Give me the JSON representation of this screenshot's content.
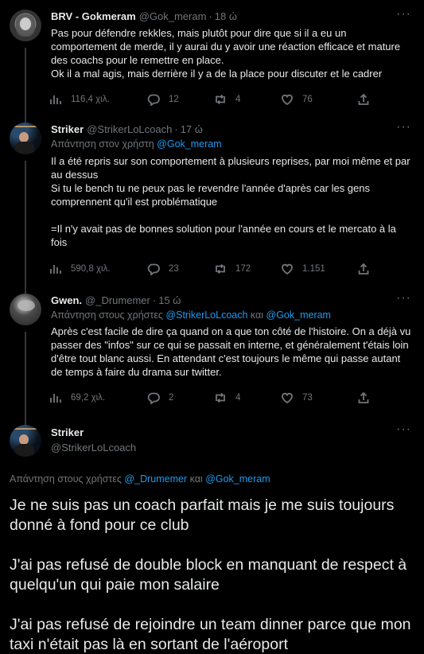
{
  "tweets": [
    {
      "name": "BRV - Gokmeram",
      "handle": "@Gok_meram",
      "time": "18 ώ",
      "text": "Pas pour défendre rekkles, mais plutôt pour dire que si il a eu un comportement de merde, il y aurai du y avoir une réaction efficace et mature des coachs pour le remettre en place.\nOk il a mal agis, mais derrière il y a de la place pour discuter et le cadrer",
      "views": "116,4 χιλ.",
      "replies": "12",
      "retweets": "4",
      "likes": "76"
    },
    {
      "name": "Striker",
      "handle": "@StrikerLoLcoach",
      "time": "17 ώ",
      "replying_prefix": "Απάντηση στον χρήστη",
      "replying_to": "@Gok_meram",
      "text": "Il a été repris sur son comportement à plusieurs reprises, par moi même et par au dessus\nSi tu le bench tu ne peux pas le revendre l'année d'après car les gens comprennent qu'il est problématique\n\n=Il n'y avait pas de bonnes solution pour l'année en cours et le mercato à la fois",
      "views": "590,8 χιλ.",
      "replies": "23",
      "retweets": "172",
      "likes": "1.151"
    },
    {
      "name": "Gwen.",
      "handle": "@_Drumemer",
      "time": "15 ώ",
      "replying_prefix": "Απάντηση στους χρήστες",
      "replying_to": "@StrikerLoLcoach",
      "replying_and": "και",
      "replying_to2": "@Gok_meram",
      "text": "Après c'est facile de dire ça quand on a que ton côté de l'histoire. On a déjà vu passer des \"infos\" sur ce qui se passait en interne, et généralement t'étais loin d'être tout blanc aussi. En attendant c'est toujours le même qui passe autant de temps à faire du drama sur twitter.",
      "views": "69,2 χιλ.",
      "replies": "2",
      "retweets": "4",
      "likes": "73"
    }
  ],
  "main": {
    "name": "Striker",
    "handle": "@StrikerLoLcoach",
    "replying_prefix": "Απάντηση στους χρήστες",
    "replying_to": "@_Drumemer",
    "replying_and": "και",
    "replying_to2": "@Gok_meram",
    "text": "Je ne suis pas un coach parfait mais je me suis toujours donné à fond pour ce club\n\nJ'ai pas refusé de double block en manquant de respect à quelqu'un qui paie mon salaire\n\nJ'ai pas refusé de rejoindre un team dinner parce que mon taxi n'était pas là en sortant de l'aéroport"
  },
  "more_label": "···",
  "dot": "·",
  "colors": {
    "background": "#000000",
    "text": "#e7e9ea",
    "muted": "#71767b",
    "link": "#1d9bf0",
    "line": "#333639"
  },
  "icons": [
    "views-icon",
    "reply-icon",
    "retweet-icon",
    "like-icon",
    "share-icon",
    "more-icon"
  ]
}
